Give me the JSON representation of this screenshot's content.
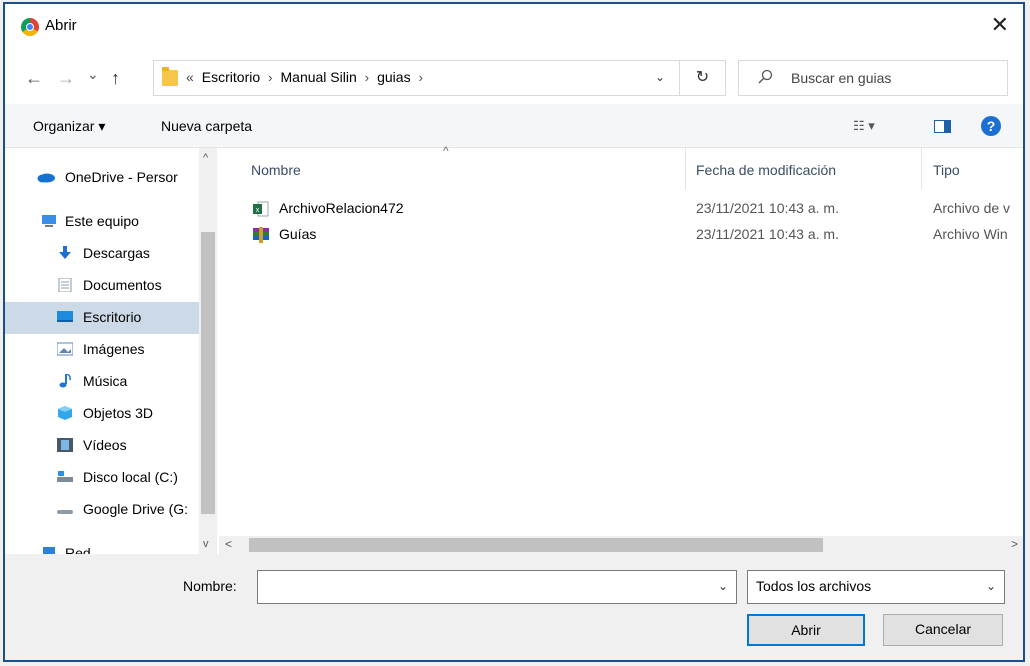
{
  "window": {
    "title": "Abrir",
    "icon": "chrome-icon",
    "close_symbol": "✕"
  },
  "nav": {
    "back_symbol": "←",
    "forward_symbol": "→",
    "recent_symbol": "⌄",
    "up_symbol": "↑",
    "breadcrumb_prefix": "«",
    "breadcrumbs": [
      "Escritorio",
      "Manual Silin",
      "guias"
    ],
    "separator": "›",
    "dropdown_symbol": "⌄",
    "refresh_symbol": "↻",
    "search_placeholder": "Buscar en guias"
  },
  "toolbar": {
    "organize_label": "Organizar ▾",
    "new_folder_label": "Nueva carpeta",
    "view_label": "☷ ▾",
    "help_label": "?"
  },
  "sidebar": {
    "items": [
      {
        "label": "OneDrive - Persor",
        "icon": "onedrive-icon",
        "color": "#1473d0"
      },
      {
        "label": "Este equipo",
        "icon": "computer-icon",
        "color": "#3a8ee6"
      },
      {
        "label": "Descargas",
        "icon": "download-icon",
        "color": "#1f6fd0"
      },
      {
        "label": "Documentos",
        "icon": "documents-icon",
        "color": "#8a99a8"
      },
      {
        "label": "Escritorio",
        "icon": "desktop-icon",
        "color": "#1d8ce0",
        "active": true
      },
      {
        "label": "Imágenes",
        "icon": "pictures-icon",
        "color": "#5f87b2"
      },
      {
        "label": "Música",
        "icon": "music-icon",
        "color": "#1f74d8"
      },
      {
        "label": "Objetos 3D",
        "icon": "objects3d-icon",
        "color": "#35a7e8"
      },
      {
        "label": "Vídeos",
        "icon": "videos-icon",
        "color": "#4a5865"
      },
      {
        "label": "Disco local (C:)",
        "icon": "drive-icon",
        "color": "#7d8b96"
      },
      {
        "label": "Google Drive (G:",
        "icon": "drive-icon",
        "color": "#8f9aa3"
      },
      {
        "label": "Red",
        "icon": "network-icon",
        "color": "#2e7fd6"
      }
    ],
    "scroll_up": "^",
    "scroll_down": "v"
  },
  "columns": {
    "name": "Nombre",
    "date": "Fecha de modificación",
    "type": "Tipo",
    "sort_symbol": "^"
  },
  "files": [
    {
      "name": "ArchivoRelacion472",
      "date": "23/11/2021 10:43 a. m.",
      "type": "Archivo de v",
      "icon": "excel-csv-icon"
    },
    {
      "name": "Guías",
      "date": "23/11/2021 10:43 a. m.",
      "type": "Archivo Win",
      "icon": "winrar-icon"
    }
  ],
  "hscroll": {
    "left_symbol": "<",
    "right_symbol": ">"
  },
  "footer": {
    "filename_label": "Nombre:",
    "filename_value": "",
    "dropdown_symbol": "⌄",
    "filetype_value": "Todos los archivos",
    "open_label": "Abrir",
    "cancel_label": "Cancelar"
  }
}
